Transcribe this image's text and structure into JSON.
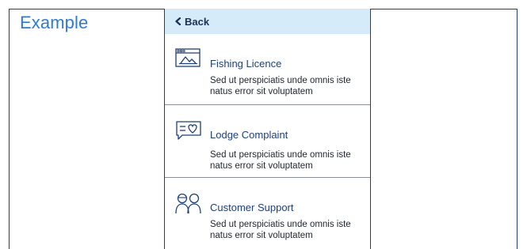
{
  "page": {
    "title": "Example"
  },
  "nav": {
    "back_label": "Back"
  },
  "menu": {
    "items": [
      {
        "title": "Fishing Licence",
        "description": "Sed ut perspiciatis unde omnis iste natus error sit voluptatem",
        "icon": "browser-image-icon"
      },
      {
        "title": "Lodge Complaint",
        "description": "Sed ut perspiciatis unde omnis iste natus error sit voluptatem",
        "icon": "heart-chat-icon"
      },
      {
        "title": "Customer Support",
        "description": "Sed ut perspiciatis unde omnis iste natus error sit voluptatem",
        "icon": "people-icon"
      }
    ]
  },
  "colors": {
    "accent": "#2e7bd6",
    "border": "#1f3f7a",
    "header_bg": "#d6ebfa"
  }
}
